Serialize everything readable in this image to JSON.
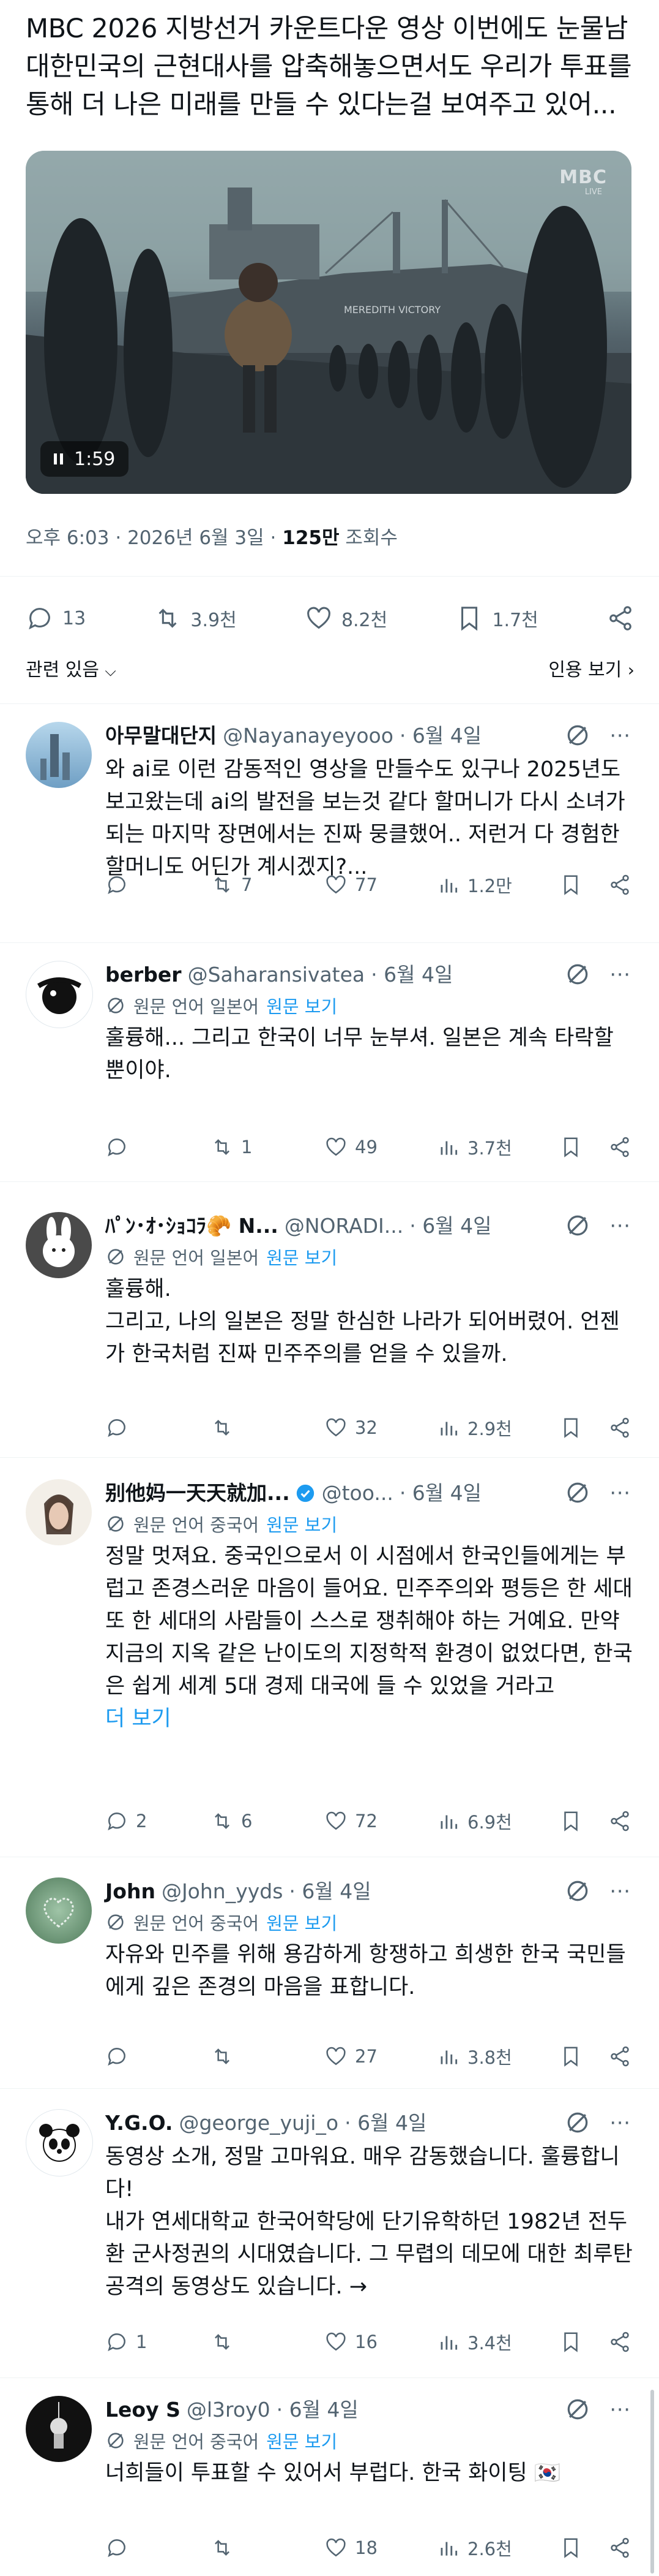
{
  "post": {
    "text": "MBC 2026 지방선거 카운트다운 영상 이번에도 눈물남 대한민국의 근현대사를 압축해놓으면서도 우리가 투표를 통해 더 나은 미래를 만들 수 있다는걸 보여주고 있어...",
    "video": {
      "logo": "MBC",
      "logo_sub": "LIVE",
      "ship_name": "MEREDITH VICTORY",
      "duration": "1:59"
    },
    "meta": {
      "time": "오후 6:03 · 2026년 6월 3일 · ",
      "views_count": "125만",
      "views_label": " 조회수"
    },
    "stats": {
      "replies": "13",
      "reposts": "3.9천",
      "likes": "8.2천",
      "bookmarks": "1.7천"
    }
  },
  "filters": {
    "relevant": "관련 있음",
    "quotes": "인용 보기"
  },
  "translate": {
    "original": "원문 보기"
  },
  "replies": [
    {
      "name": "아무말대단지",
      "handle": "@Nayanayeyooo",
      "date": "· 6월 4일",
      "translated_from": "",
      "text": "와 ai로 이런 감동적인 영상을 만들수도 있구나 2025년도 보고왔는데 ai의 발전을 보는것 같다 할머니가 다시 소녀가 되는 마지막 장면에서는 진짜 뭉클했어.. 저런거 다 경험한 할머니도 어딘가 계시겠지?...",
      "more": "",
      "replies": "",
      "reposts": "7",
      "likes": "77",
      "views": "1.2만"
    },
    {
      "name": "berber",
      "handle": "@Saharansivatea",
      "date": "· 6월 4일",
      "translated_from": "원문 언어 일본어",
      "text": "훌륭해... 그리고 한국이 너무 눈부셔. 일본은 계속 타락할 뿐이야.",
      "more": "",
      "replies": "",
      "reposts": "1",
      "likes": "49",
      "views": "3.7천"
    },
    {
      "name": "ﾊﾟﾝ･ｵ･ｼｮｺﾗ🥐 N...",
      "handle": "@NORADI...",
      "date": "· 6월 4일",
      "translated_from": "원문 언어 일본어",
      "text": "훌륭해.\n그리고, 나의 일본은 정말 한심한 나라가 되어버렸어. 언젠가 한국처럼 진짜 민주주의를 얻을 수 있을까.",
      "more": "",
      "replies": "",
      "reposts": "",
      "likes": "32",
      "views": "2.9천"
    },
    {
      "name": "别他妈一天天就加...",
      "handle": "@too...",
      "date": "· 6월 4일",
      "translated_from": "원문 언어 중국어",
      "text": "정말 멋져요. 중국인으로서 이 시점에서 한국인들에게는 부럽고 존경스러운 마음이 들어요. 민주주의와 평등은 한 세대 또 한 세대의 사람들이 스스로 쟁취해야 하는 거예요. 만약 지금의 지옥 같은 난이도의 지정학적 환경이 없었다면, 한국은 쉽게 세계 5대 경제 대국에 들 수 있었을 거라고",
      "more": "더 보기",
      "replies": "2",
      "reposts": "6",
      "likes": "72",
      "views": "6.9천"
    },
    {
      "name": "John",
      "handle": "@John_yyds",
      "date": "· 6월 4일",
      "translated_from": "원문 언어 중국어",
      "text": "자유와 민주를 위해 용감하게 항쟁하고 희생한 한국 국민들에게 깊은 존경의 마음을 표합니다.",
      "more": "",
      "replies": "",
      "reposts": "",
      "likes": "27",
      "views": "3.8천"
    },
    {
      "name": "Y.G.O.",
      "handle": "@george_yuji_o",
      "date": "· 6월 4일",
      "translated_from": "",
      "text": "동영상 소개, 정말 고마워요. 매우 감동했습니다. 훌륭합니다!\n내가 연세대학교 한국어학당에 단기유학하던 1982년 전두환 군사정권의 시대였습니다. 그 무렵의 데모에 대한 최루탄 공격의 동영상도 있습니다. →",
      "more": "",
      "replies": "1",
      "reposts": "",
      "likes": "16",
      "views": "3.4천"
    },
    {
      "name": "Leoy S",
      "handle": "@l3roy0",
      "date": "· 6월 4일",
      "translated_from": "원문 언어 중국어",
      "text": "너희들이 투표할 수 있어서 부럽다. 한국 화이팅 🇰🇷",
      "more": "",
      "replies": "",
      "reposts": "",
      "likes": "18",
      "views": "2.6천"
    }
  ],
  "colors": {
    "text": "#0f1419",
    "muted": "#536471",
    "link": "#1d9bf0",
    "verified": "#1d9bf0",
    "divider": "#eff3f4"
  }
}
